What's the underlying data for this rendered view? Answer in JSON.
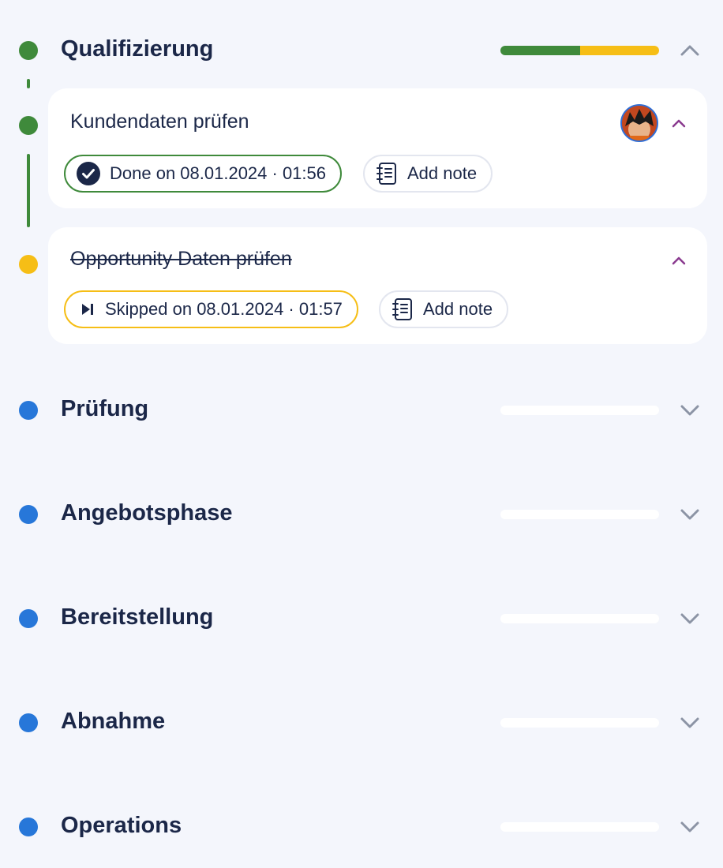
{
  "colors": {
    "done": "#3f8a3b",
    "skipped": "#f6be16",
    "pending": "#2777d9",
    "text": "#1b2748",
    "chevron_muted": "#8c94a5",
    "chevron_accent": "#8a3a8f"
  },
  "phases": [
    {
      "title": "Qualifizierung",
      "status": "done",
      "expanded": true,
      "progress": {
        "done_fraction": 0.5,
        "skipped_fraction": 0.5
      },
      "chevron_icon": "chevron-up-icon",
      "tasks": [
        {
          "title": "Kundendaten prüfen",
          "status": "done",
          "status_label": "Done on 08.01.2024 · 01:56",
          "status_icon": "check-circle-icon",
          "note_label": "Add note",
          "note_icon": "notebook-icon",
          "assignee_icon": "avatar",
          "chevron_icon": "chevron-up-icon"
        },
        {
          "title": "Opportunity Daten prüfen",
          "status": "skipped",
          "status_label": "Skipped on 08.01.2024 · 01:57",
          "status_icon": "skip-forward-icon",
          "note_label": "Add note",
          "note_icon": "notebook-icon",
          "chevron_icon": "chevron-up-icon"
        }
      ]
    },
    {
      "title": "Prüfung",
      "status": "pending",
      "expanded": false,
      "progress": {
        "done_fraction": 0,
        "skipped_fraction": 0
      },
      "chevron_icon": "chevron-down-icon"
    },
    {
      "title": "Angebotsphase",
      "status": "pending",
      "expanded": false,
      "progress": {
        "done_fraction": 0,
        "skipped_fraction": 0
      },
      "chevron_icon": "chevron-down-icon"
    },
    {
      "title": "Bereitstellung",
      "status": "pending",
      "expanded": false,
      "progress": {
        "done_fraction": 0,
        "skipped_fraction": 0
      },
      "chevron_icon": "chevron-down-icon"
    },
    {
      "title": "Abnahme",
      "status": "pending",
      "expanded": false,
      "progress": {
        "done_fraction": 0,
        "skipped_fraction": 0
      },
      "chevron_icon": "chevron-down-icon"
    },
    {
      "title": "Operations",
      "status": "pending",
      "expanded": false,
      "progress": {
        "done_fraction": 0,
        "skipped_fraction": 0
      },
      "chevron_icon": "chevron-down-icon"
    }
  ]
}
